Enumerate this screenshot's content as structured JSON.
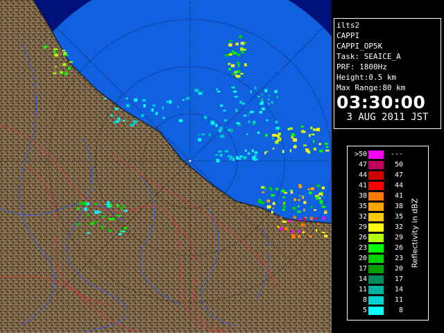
{
  "info": {
    "lines": [
      "ilts2",
      "CAPPI",
      "CAPPI_OP5K",
      "Task: SEAICE_A",
      "PRF: 1800Hz",
      "Height:0.5 km",
      "Max Range:80 km"
    ],
    "time": "03:30:00",
    "date": "3 AUG 2011 JST"
  },
  "legend": {
    "title": "Reflectivity in dBZ",
    "rows": [
      {
        "lo": ">50",
        "hi": "---",
        "color": "#ff00ff"
      },
      {
        "lo": "47",
        "hi": "50",
        "color": "#c0005a"
      },
      {
        "lo": "44",
        "hi": "47",
        "color": "#d00000"
      },
      {
        "lo": "41",
        "hi": "44",
        "color": "#ff0000"
      },
      {
        "lo": "38",
        "hi": "41",
        "color": "#ff7800"
      },
      {
        "lo": "35",
        "hi": "38",
        "color": "#ffa500"
      },
      {
        "lo": "32",
        "hi": "35",
        "color": "#ffc800"
      },
      {
        "lo": "29",
        "hi": "32",
        "color": "#ffff00"
      },
      {
        "lo": "26",
        "hi": "29",
        "color": "#b4ff00"
      },
      {
        "lo": "23",
        "hi": "26",
        "color": "#00ff00"
      },
      {
        "lo": "20",
        "hi": "23",
        "color": "#00d200"
      },
      {
        "lo": "17",
        "hi": "20",
        "color": "#00a000"
      },
      {
        "lo": "14",
        "hi": "17",
        "color": "#008c5a"
      },
      {
        "lo": "11",
        "hi": "14",
        "color": "#00b4a0"
      },
      {
        "lo": "8",
        "hi": "11",
        "color": "#00d2d2"
      },
      {
        "lo": "5",
        "hi": "8",
        "color": "#00ffff"
      }
    ]
  },
  "map_colors": {
    "sea": "#1060e0",
    "outside": "#00107a",
    "land": "#786448",
    "land_dark": "#4a3a28",
    "rivers": "#3c5ad2",
    "boundaries": "#c83c3c",
    "range_rings": "#000000"
  }
}
